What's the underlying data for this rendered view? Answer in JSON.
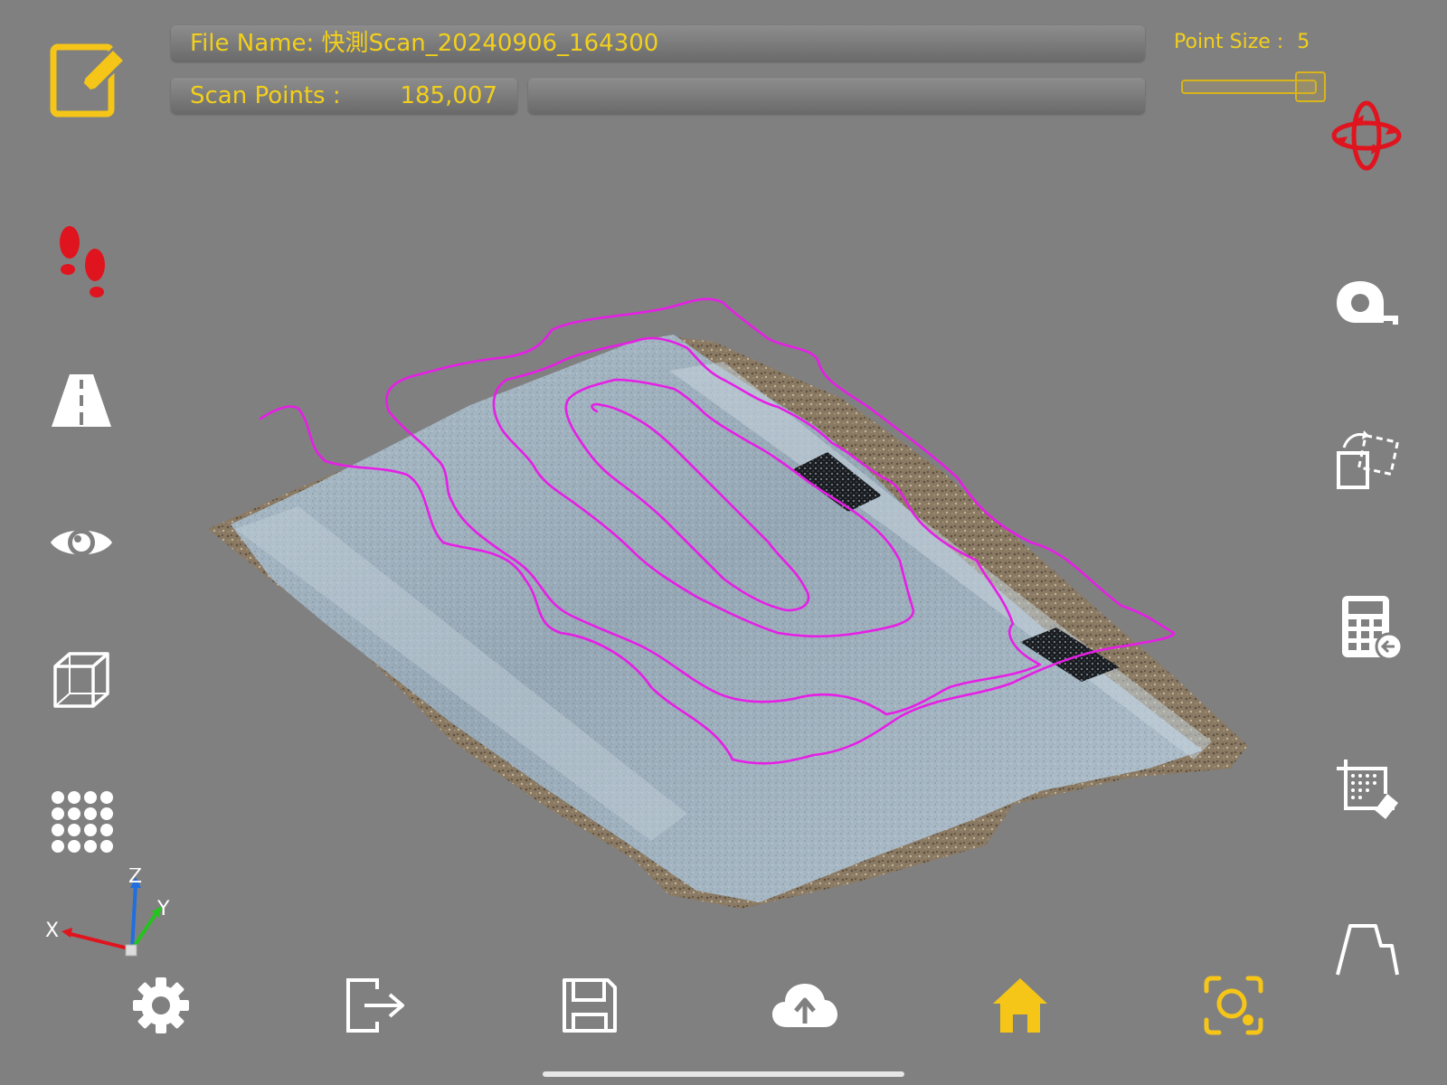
{
  "header": {
    "file_name_label": "File Name:",
    "file_name_value": "快測Scan_20240906_164300",
    "scan_points_label": "Scan Points :",
    "scan_points_value": "185,007",
    "point_size_label": "Point Size :",
    "point_size_value": "5"
  },
  "point_size_slider": {
    "fraction": 0.95
  },
  "axes": {
    "x": "X",
    "y": "Y",
    "z": "Z"
  },
  "icons": {
    "edit": "edit-icon",
    "footsteps": "footsteps-icon",
    "road": "road-icon",
    "eye": "eye-icon",
    "cube": "cube-icon",
    "dots": "point-grid-icon",
    "orbit": "orbit-icon",
    "tape": "tape-measure-icon",
    "transform": "transform-icon",
    "calculator": "calculator-icon",
    "crop": "crop-erase-icon",
    "profile": "profile-icon",
    "settings": "gear-icon",
    "exit": "exit-icon",
    "save": "save-icon",
    "upload": "cloud-upload-icon",
    "home": "home-icon",
    "capture": "capture-icon"
  },
  "colors": {
    "background": "#808080",
    "accent_yellow": "#f5c518",
    "active_red": "#e0141e",
    "contour": "#e61ee6",
    "icon_white": "#ffffff"
  }
}
